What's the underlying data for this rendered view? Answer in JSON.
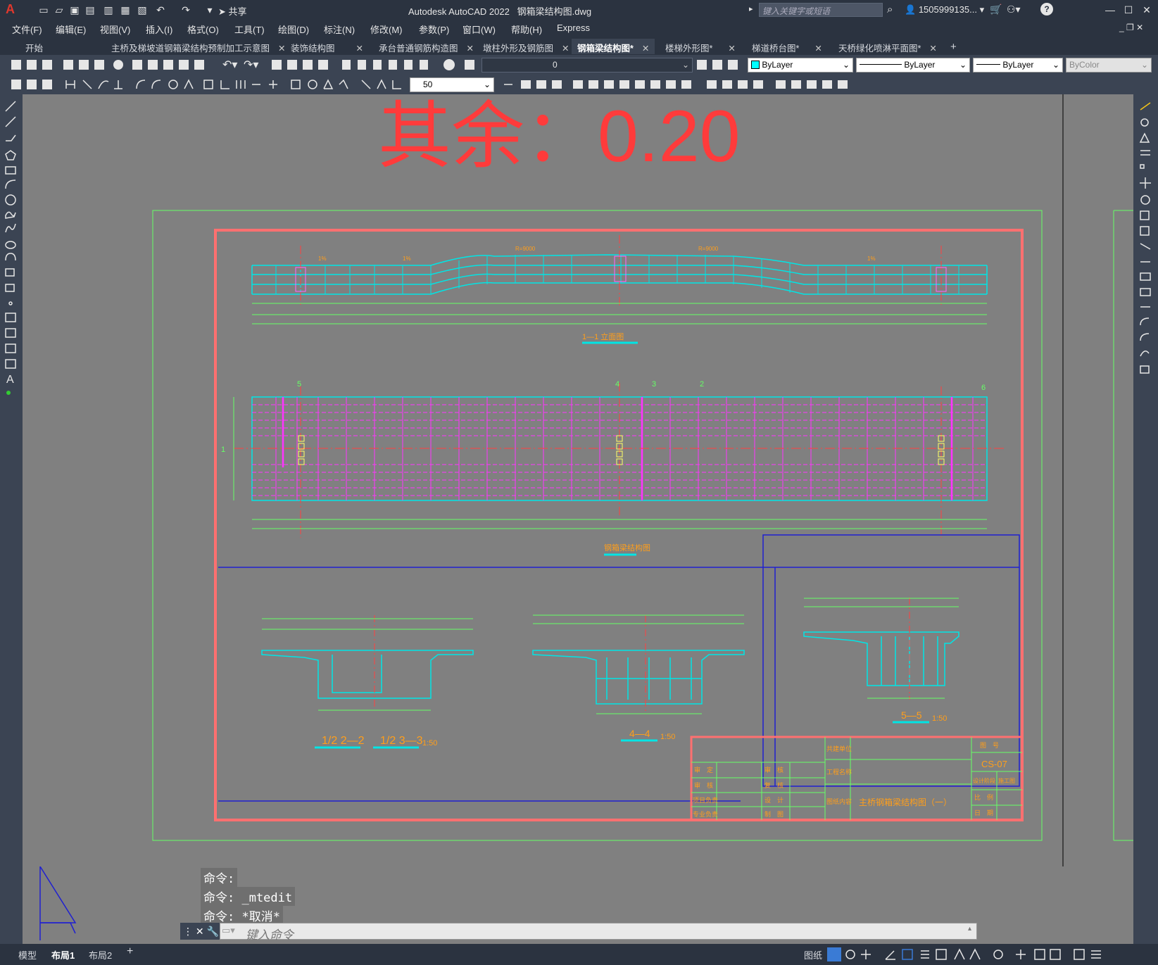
{
  "app": {
    "title": "Autodesk AutoCAD 2022",
    "file": "钢箱梁结构图.dwg",
    "share_label": "共享",
    "search_placeholder": "键入关键字或短语",
    "user": "1505999135..."
  },
  "menu": [
    "文件(F)",
    "编辑(E)",
    "视图(V)",
    "插入(I)",
    "格式(O)",
    "工具(T)",
    "绘图(D)",
    "标注(N)",
    "修改(M)",
    "参数(P)",
    "窗口(W)",
    "帮助(H)",
    "Express"
  ],
  "tabs": [
    {
      "label": "开始",
      "closable": false,
      "active": false
    },
    {
      "label": "主桥及梯坡道钢箱梁结构预制加工示意图",
      "closable": true,
      "active": false
    },
    {
      "label": "装饰结构图",
      "closable": true,
      "active": false
    },
    {
      "label": "承台普通钢筋构造图",
      "closable": true,
      "active": false
    },
    {
      "label": "墩柱外形及钢筋图",
      "closable": true,
      "active": false
    },
    {
      "label": "钢箱梁结构图*",
      "closable": true,
      "active": true
    },
    {
      "label": "楼梯外形图*",
      "closable": true,
      "active": false
    },
    {
      "label": "梯道桥台图*",
      "closable": true,
      "active": false
    },
    {
      "label": "天桥绿化喷淋平面图*",
      "closable": true,
      "active": false
    }
  ],
  "toolbar": {
    "layer_value": "0",
    "color_value": "ByLayer",
    "linetype_value": "ByLayer",
    "lineweight_value": "ByLayer",
    "plotstyle_value": "ByColor",
    "dimscale_value": "50"
  },
  "drawing": {
    "note": "其余：0.20",
    "section_title_top": "1—1 立面图",
    "section_title_plan": "钢箱梁结构图",
    "sec_2": "1/2 2—2",
    "sec_3": "1/2 3—3",
    "sec_4": "4—4",
    "sec_5": "5—5",
    "scale": "1:50",
    "title_block": {
      "unit_label": "共建单位",
      "project_label": "工程名称",
      "content_label": "图纸内容",
      "content_value": "主桥钢箱梁结构图（一）",
      "drawing_no_label": "图　号",
      "drawing_no": "CS-07",
      "design_stage_label": "设计阶段",
      "design_stage": "施工图",
      "scale_label": "比　例",
      "date_label": "日　期",
      "left_rows": [
        "审　定",
        "审　核",
        "项目负责",
        "专业负责"
      ],
      "mid_rows": [
        "审　核",
        "复　核",
        "设　计",
        "制　图"
      ]
    },
    "labels_sec": [
      "5",
      "4",
      "3",
      "2",
      "6",
      "1"
    ]
  },
  "command": {
    "lines": [
      "命令:",
      "命令: _mtedit",
      "命令: *取消*"
    ],
    "placeholder": "键入命令"
  },
  "layout_tabs": [
    {
      "label": "模型",
      "active": false
    },
    {
      "label": "布局1",
      "active": true
    },
    {
      "label": "布局2",
      "active": false
    }
  ],
  "status": {
    "paper_label": "图纸"
  }
}
